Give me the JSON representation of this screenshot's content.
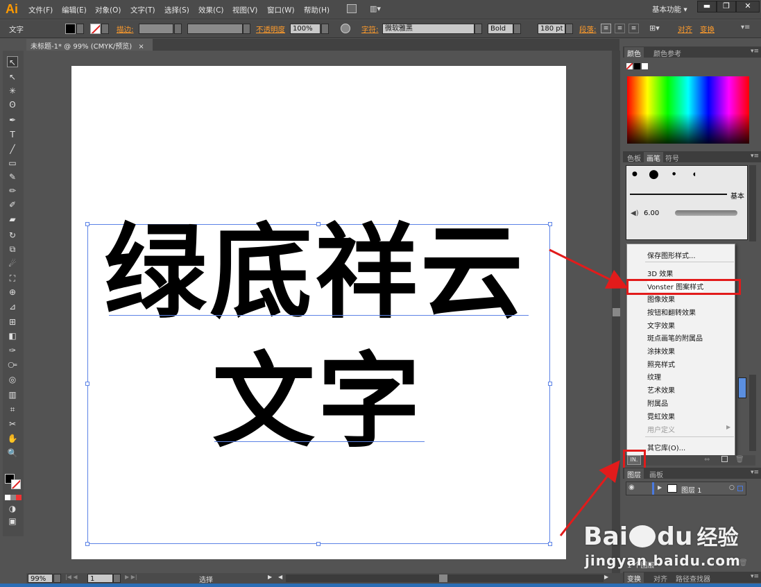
{
  "app": {
    "logo": "Ai"
  },
  "menu": [
    "文件(F)",
    "编辑(E)",
    "对象(O)",
    "文字(T)",
    "选择(S)",
    "效果(C)",
    "视图(V)",
    "窗口(W)",
    "帮助(H)"
  ],
  "workspace": {
    "label": "基本功能"
  },
  "control": {
    "tool_label": "文字",
    "stroke_label": "描边:",
    "opacity_label": "不透明度",
    "opacity_value": "100%",
    "char_label": "字符:",
    "font_name": "微软雅黑",
    "font_style": "Bold",
    "font_size": "180 pt",
    "para_label": "段落:",
    "align_label": "对齐",
    "transform_label": "变换"
  },
  "document": {
    "tab": "未标题-1* @ 99% (CMYK/预览)",
    "close": "×"
  },
  "canvas": {
    "line1": "绿底祥云",
    "line2": "文字"
  },
  "panels": {
    "color_tab": "颜色",
    "color_guide_tab": "颜色参考",
    "swatches_tab": "色板",
    "brushes_tab": "画笔",
    "symbols_tab": "符号",
    "brush_basic": "基本",
    "brush_size": "6.00",
    "layers_tab": "图层",
    "artboards_tab": "画板",
    "layer_name": "图层 1",
    "layer_count": "1 个图层",
    "transform_tab": "变换",
    "align_tab": "对齐",
    "pathfinder_tab": "路径查找器"
  },
  "dropdown": {
    "items": [
      "保存图形样式...",
      "3D 效果",
      "Vonster 图案样式",
      "图像效果",
      "按钮和翻转效果",
      "文字效果",
      "斑点画笔的附属品",
      "涂抹效果",
      "照亮样式",
      "纹理",
      "艺术效果",
      "附属品",
      "霓虹效果",
      "用户定义",
      "其它库(O)..."
    ],
    "highlighted": "Vonster 图案样式"
  },
  "status": {
    "zoom": "99%",
    "page": "1",
    "tool": "选择"
  },
  "watermark": {
    "brand_a": "Bai",
    "brand_b": "du",
    "brand_cn": "经验",
    "url": "jingyan.baidu.com"
  },
  "colors": {
    "accent": "#ff9a00",
    "highlight_red": "#e21b1b",
    "selection_blue": "#5b82e6"
  }
}
